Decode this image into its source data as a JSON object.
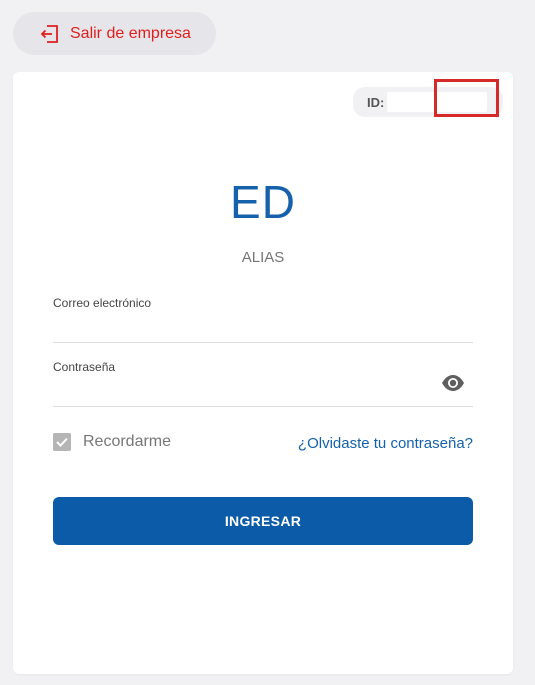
{
  "header": {
    "exit_label": "Salir de empresa",
    "exit_icon": "logout-icon"
  },
  "card": {
    "id_label": "ID:",
    "initials": "ED",
    "alias": "ALIAS"
  },
  "form": {
    "email_label": "Correo electrónico",
    "email_value": "",
    "password_label": "Contraseña",
    "password_value": "",
    "password_toggle_icon": "eye-icon",
    "remember_label": "Recordarme",
    "remember_checked": true,
    "forgot_label": "¿Olvidaste tu contraseña?",
    "submit_label": "INGRESAR"
  },
  "colors": {
    "brand": "#0b5ba8",
    "exit": "#e0201f",
    "highlight": "#d42a2a",
    "background": "#f1f1f4"
  }
}
